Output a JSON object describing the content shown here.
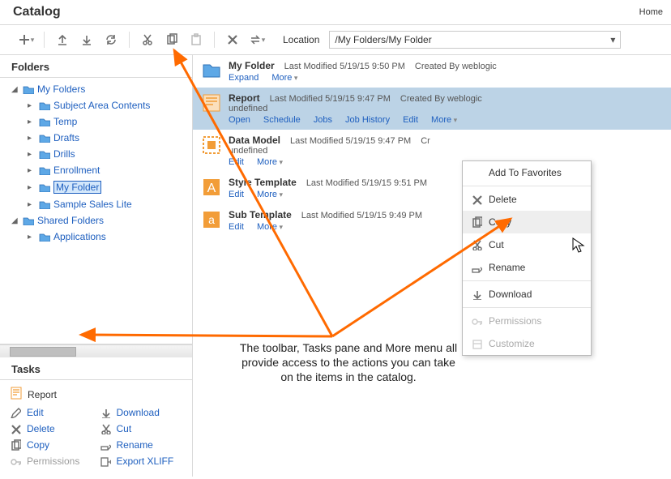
{
  "page": {
    "title": "Catalog",
    "home": "Home"
  },
  "location": {
    "label": "Location",
    "path": "/My Folders/My Folder"
  },
  "folders": {
    "title": "Folders",
    "items": [
      {
        "label": "My Folders"
      },
      {
        "label": "Subject Area Contents"
      },
      {
        "label": "Temp"
      },
      {
        "label": "Drafts"
      },
      {
        "label": "Drills"
      },
      {
        "label": "Enrollment"
      },
      {
        "label": "My Folder"
      },
      {
        "label": "Sample Sales Lite"
      },
      {
        "label": "Shared Folders"
      },
      {
        "label": "Applications"
      }
    ]
  },
  "tasks": {
    "title": "Tasks",
    "context_label": "Report",
    "items": [
      {
        "label": "Edit"
      },
      {
        "label": "Download"
      },
      {
        "label": "Delete"
      },
      {
        "label": "Cut"
      },
      {
        "label": "Copy"
      },
      {
        "label": "Rename"
      },
      {
        "label": "Permissions"
      },
      {
        "label": "Export XLIFF"
      }
    ]
  },
  "list": [
    {
      "name": "My Folder",
      "modified": "Last Modified 5/19/15 9:50 PM",
      "created": "Created By weblogic",
      "undefined": "",
      "actions": [
        "Expand",
        "More"
      ]
    },
    {
      "name": "Report",
      "modified": "Last Modified 5/19/15 9:47 PM",
      "created": "Created By weblogic",
      "undefined": "undefined",
      "actions": [
        "Open",
        "Schedule",
        "Jobs",
        "Job History",
        "Edit",
        "More"
      ]
    },
    {
      "name": "Data Model",
      "modified": "Last Modified 5/19/15 9:47 PM",
      "created": "Cr",
      "undefined": "undefined",
      "actions": [
        "Edit",
        "More"
      ]
    },
    {
      "name": "Style Template",
      "modified": "Last Modified 5/19/15 9:51 PM",
      "created": "",
      "undefined": "",
      "actions": [
        "Edit",
        "More"
      ]
    },
    {
      "name": "Sub Template",
      "modified": "Last Modified 5/19/15 9:49 PM",
      "created": "",
      "undefined": "",
      "actions": [
        "Edit",
        "More"
      ]
    }
  ],
  "context_menu": [
    {
      "label": "Add To Favorites",
      "icon": "none"
    },
    {
      "label": "Delete",
      "icon": "delete"
    },
    {
      "label": "Copy",
      "icon": "copy"
    },
    {
      "label": "Cut",
      "icon": "cut"
    },
    {
      "label": "Rename",
      "icon": "rename"
    },
    {
      "label": "Download",
      "icon": "download"
    },
    {
      "label": "Permissions",
      "icon": "permissions",
      "disabled": true
    },
    {
      "label": "Customize",
      "icon": "customize",
      "disabled": true
    }
  ],
  "annotation": "The toolbar, Tasks pane and More menu all provide access to the actions you can take on the items in the catalog."
}
